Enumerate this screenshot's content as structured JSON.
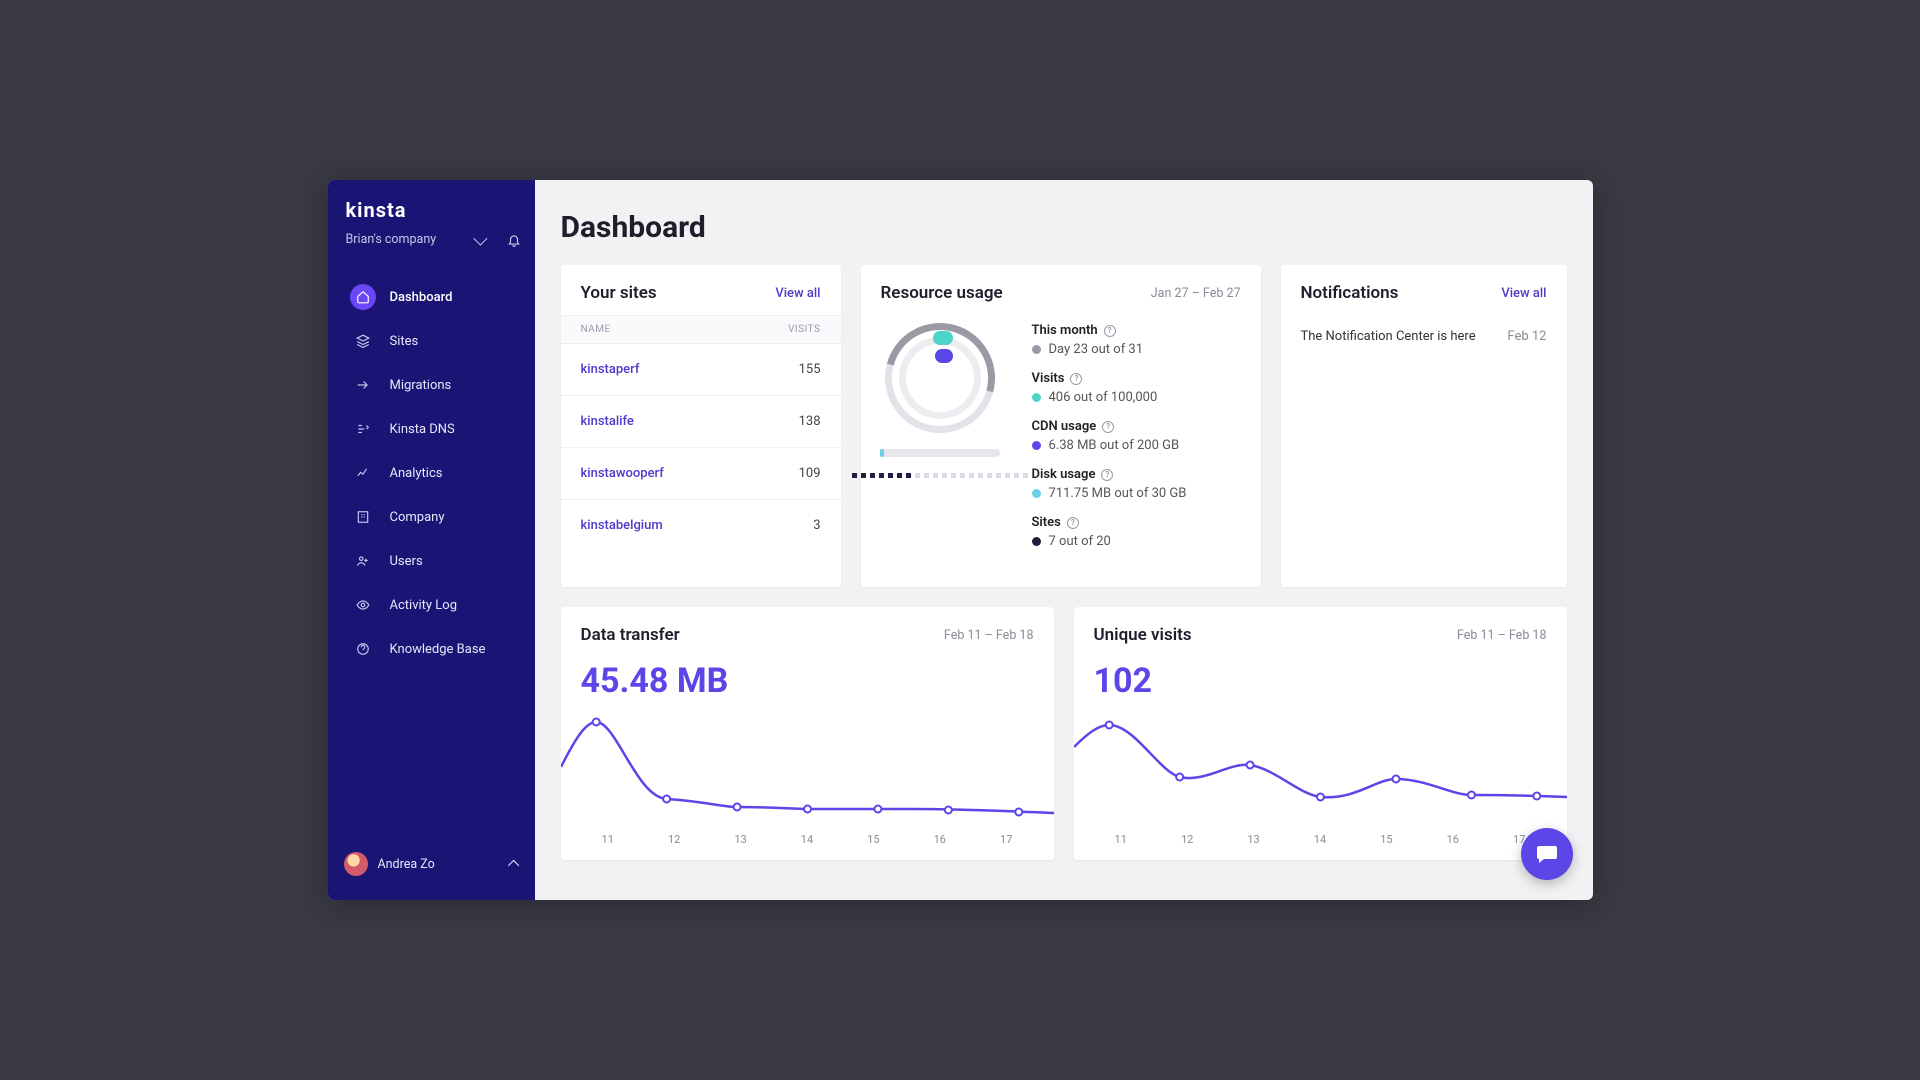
{
  "brand": "kinsta",
  "company_selector": {
    "name": "Brian's company"
  },
  "nav": {
    "items": [
      {
        "label": "Dashboard",
        "icon": "home-icon",
        "active": true
      },
      {
        "label": "Sites",
        "icon": "layers-icon"
      },
      {
        "label": "Migrations",
        "icon": "migrate-icon"
      },
      {
        "label": "Kinsta DNS",
        "icon": "dns-icon"
      },
      {
        "label": "Analytics",
        "icon": "analytics-icon"
      },
      {
        "label": "Company",
        "icon": "building-icon"
      },
      {
        "label": "Users",
        "icon": "users-icon"
      },
      {
        "label": "Activity Log",
        "icon": "eye-icon"
      },
      {
        "label": "Knowledge Base",
        "icon": "help-icon"
      }
    ]
  },
  "user": {
    "name": "Andrea Zo"
  },
  "page": {
    "title": "Dashboard"
  },
  "sites_card": {
    "title": "Your sites",
    "view_all": "View all",
    "col_name": "NAME",
    "col_visits": "VISITS",
    "rows": [
      {
        "name": "kinstaperf",
        "visits": "155"
      },
      {
        "name": "kinstalife",
        "visits": "138"
      },
      {
        "name": "kinstawooperf",
        "visits": "109"
      },
      {
        "name": "kinstabelgium",
        "visits": "3"
      }
    ]
  },
  "resource_card": {
    "title": "Resource usage",
    "date_range": "Jan 27 – Feb 27",
    "stats": {
      "month": {
        "label": "This month",
        "value": "Day 23 out of 31"
      },
      "visits": {
        "label": "Visits",
        "value": "406 out of 100,000"
      },
      "cdn": {
        "label": "CDN usage",
        "value": "6.38 MB out of 200 GB"
      },
      "disk": {
        "label": "Disk usage",
        "value": "711.75 MB out of 30 GB"
      },
      "sites": {
        "label": "Sites",
        "value": "7 out of 20"
      }
    }
  },
  "notifications_card": {
    "title": "Notifications",
    "view_all": "View all",
    "items": [
      {
        "text": "The Notification Center is here",
        "date": "Feb 12"
      }
    ]
  },
  "data_transfer_card": {
    "title": "Data transfer",
    "date_range": "Feb 11 – Feb 18",
    "value": "45.48 MB"
  },
  "unique_visits_card": {
    "title": "Unique visits",
    "date_range": "Feb 11 – Feb 18",
    "value": "102"
  },
  "chart_data": [
    {
      "type": "line",
      "title": "Data transfer",
      "xlabel": "",
      "ylabel": "",
      "categories": [
        "11",
        "12",
        "13",
        "14",
        "15",
        "16",
        "17"
      ],
      "values": [
        55,
        14,
        16,
        10,
        10,
        10,
        9
      ]
    },
    {
      "type": "line",
      "title": "Unique visits",
      "xlabel": "",
      "ylabel": "",
      "categories": [
        "11",
        "12",
        "13",
        "14",
        "15",
        "16",
        "17"
      ],
      "values": [
        48,
        24,
        30,
        20,
        28,
        22,
        22
      ]
    }
  ],
  "xaxis_ticks": [
    "11",
    "12",
    "13",
    "14",
    "15",
    "16",
    "17"
  ]
}
